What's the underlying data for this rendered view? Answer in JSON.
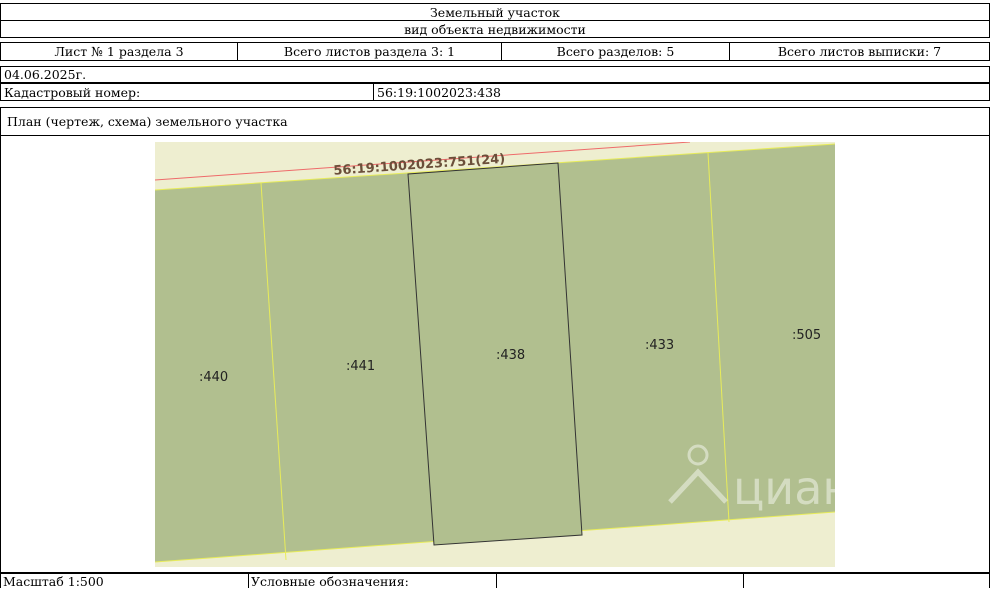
{
  "header": {
    "object_type": "Земельный участок",
    "object_kind": "вид объекта недвижимости"
  },
  "sheet_info": {
    "sheet": "Лист № 1 раздела 3",
    "sheets_in_section": "Всего листов раздела 3: 1",
    "sections_total": "Всего разделов: 5",
    "sheets_total": "Всего листов выписки: 7"
  },
  "date": "04.06.2025г.",
  "cadastral": {
    "label": "Кадастровый номер:",
    "value": "56:19:1002023:438"
  },
  "plan": {
    "title": "План (чертеж, схема) земельного участка",
    "road_parcel_label": "56:19:1002023:751(24)",
    "parcels": [
      ":440",
      ":441",
      ":438",
      ":433",
      ":505"
    ],
    "watermark": "циан"
  },
  "footer": {
    "scale": "Масштаб 1:500",
    "legend": "Условные обозначения:"
  },
  "colors": {
    "parcel_fill": "#b1bf8f",
    "road_fill": "#eeeed0",
    "boundary_line": "#e8ec5a",
    "red_line": "#ee6a6a"
  }
}
